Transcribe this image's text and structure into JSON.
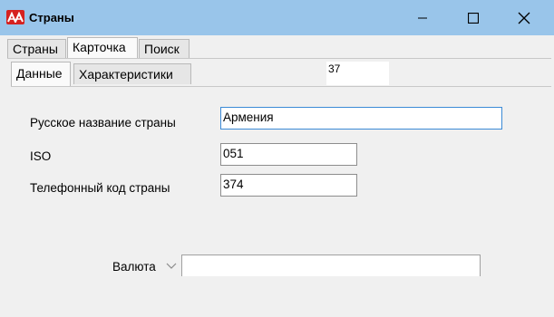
{
  "window": {
    "title": "Страны"
  },
  "tabs_top": [
    "Страны",
    "Карточка",
    "Поиск"
  ],
  "tabs_sub": [
    "Данные",
    "Характеристики"
  ],
  "record_id": "37",
  "form": {
    "name_label": "Русское название страны",
    "name_value": "Армения",
    "iso_label": "ISO",
    "iso_value": "051",
    "phone_label": "Телефонный код страны",
    "phone_value": "374",
    "currency_label": "Валюта",
    "currency_value": ""
  },
  "icons": {
    "app": "app-logo-icon",
    "currency_dropdown": "chevron-down-icon"
  },
  "colors": {
    "titlebar": "#99c5ea",
    "logo": "#d6211f",
    "focus_border": "#3b8ad6"
  }
}
